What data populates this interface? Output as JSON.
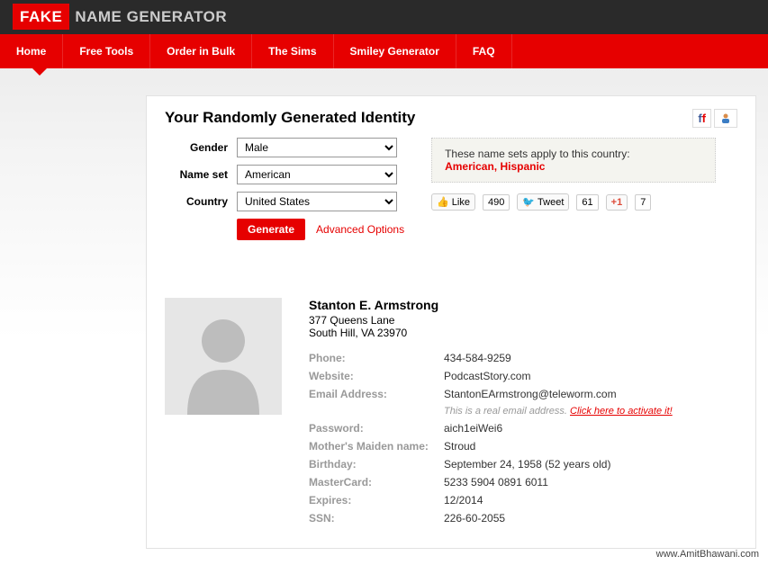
{
  "brand": {
    "fake": "FAKE",
    "rest": "NAME GENERATOR"
  },
  "nav": [
    "Home",
    "Free Tools",
    "Order in Bulk",
    "The Sims",
    "Smiley Generator",
    "FAQ"
  ],
  "title": "Your Randomly Generated Identity",
  "form": {
    "gender_label": "Gender",
    "gender_value": "Male",
    "nameset_label": "Name set",
    "nameset_value": "American",
    "country_label": "Country",
    "country_value": "United States",
    "generate": "Generate",
    "advanced": "Advanced Options"
  },
  "note": {
    "line": "These name sets apply to this country:",
    "sets": "American, Hispanic"
  },
  "social": {
    "fb_like": "Like",
    "fb_count": "490",
    "tweet": "Tweet",
    "tweet_count": "61",
    "gplus": "+1",
    "gplus_count": "7"
  },
  "profile": {
    "name": "Stanton E. Armstrong",
    "addr1": "377 Queens Lane",
    "addr2": "South Hill, VA 23970",
    "rows": [
      {
        "label": "Phone:",
        "value": "434-584-9259"
      },
      {
        "label": "Website:",
        "value": "PodcastStory.com"
      },
      {
        "label": "Email Address:",
        "value": "StantonEArmstrong@teleworm.com"
      }
    ],
    "email_note": "This is a real email address. ",
    "email_activate": "Click here to activate it!",
    "rows2": [
      {
        "label": "Password:",
        "value": "aich1eiWei6"
      },
      {
        "label": "Mother's Maiden name:",
        "value": "Stroud"
      },
      {
        "label": "Birthday:",
        "value": "September 24, 1958 (52 years old)"
      },
      {
        "label": "MasterCard:",
        "value": "5233 5904 0891 6011"
      },
      {
        "label": "Expires:",
        "value": "12/2014"
      },
      {
        "label": "SSN:",
        "value": "226-60-2055"
      }
    ]
  },
  "footer": "www.AmitBhawani.com"
}
